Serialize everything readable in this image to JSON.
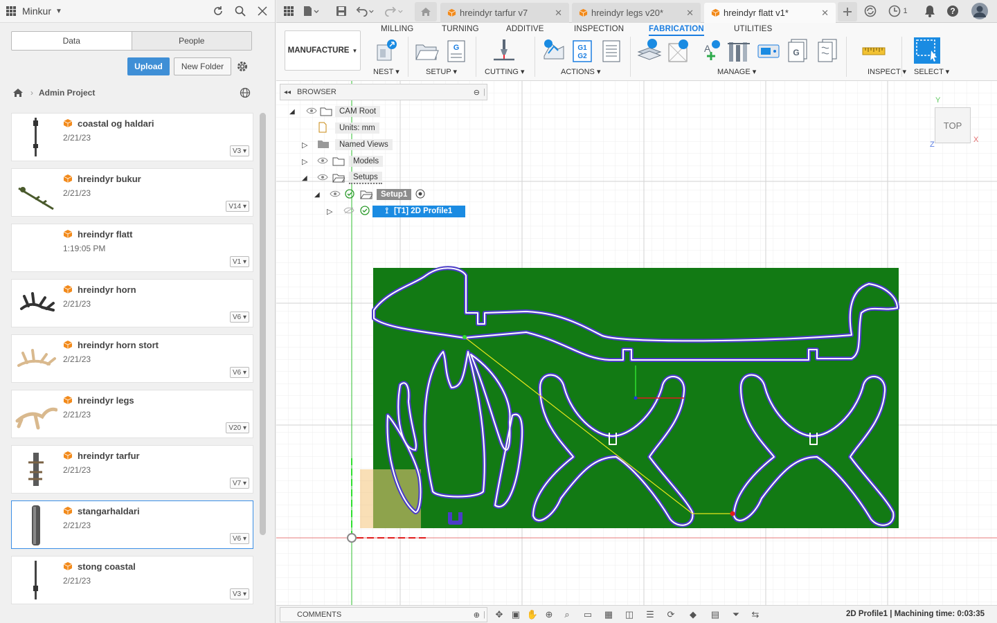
{
  "left_panel": {
    "app_name": "Minkur",
    "tabs": [
      "Data",
      "People"
    ],
    "upload_label": "Upload",
    "new_folder_label": "New Folder",
    "breadcrumb": "Admin Project",
    "files": [
      {
        "name": "coastal og haldari",
        "date": "2/21/23",
        "version": "V3"
      },
      {
        "name": "hreindyr bukur",
        "date": "2/21/23",
        "version": "V14"
      },
      {
        "name": "hreindyr flatt",
        "date": "1:19:05 PM",
        "version": "V1"
      },
      {
        "name": "hreindyr horn",
        "date": "2/21/23",
        "version": "V6"
      },
      {
        "name": "hreindyr horn stort",
        "date": "2/21/23",
        "version": "V6"
      },
      {
        "name": "hreindyr legs",
        "date": "2/21/23",
        "version": "V20"
      },
      {
        "name": "hreindyr tarfur",
        "date": "2/21/23",
        "version": "V7"
      },
      {
        "name": "stangarhaldari",
        "date": "2/21/23",
        "version": "V6",
        "selected": true
      },
      {
        "name": "stong coastal",
        "date": "2/21/23",
        "version": "V3"
      }
    ]
  },
  "doc_tabs": [
    {
      "label": "hreindyr tarfur v7",
      "active": false
    },
    {
      "label": "hreindyr legs v20*",
      "active": false
    },
    {
      "label": "hreindyr flatt v1*",
      "active": true
    }
  ],
  "notifications_count": "1",
  "ribbon": {
    "workspace": "MANUFACTURE",
    "tabs": [
      "MILLING",
      "TURNING",
      "ADDITIVE",
      "INSPECTION",
      "FABRICATION",
      "UTILITIES"
    ],
    "active_tab": "FABRICATION",
    "groups": [
      "NEST",
      "SETUP",
      "CUTTING",
      "ACTIONS",
      "MANAGE",
      "INSPECT",
      "SELECT"
    ],
    "g_code_label": "G1\nG2",
    "g_label": "G"
  },
  "browser": {
    "title": "BROWSER",
    "nodes": {
      "root": "CAM Root",
      "units": "Units: mm",
      "named_views": "Named Views",
      "models": "Models",
      "setups": "Setups",
      "setup1": "Setup1",
      "profile": "[T1] 2D Profile1"
    }
  },
  "viewcube": {
    "face": "TOP",
    "axis_x": "X",
    "axis_y": "Y",
    "axis_z": "Z"
  },
  "bottom": {
    "comments": "COMMENTS",
    "status": "2D Profile1 | Machining time: 0:03:35"
  },
  "colors": {
    "accent": "#1a7de0",
    "stock": "#127a14",
    "toolpath": "#4b3cc7",
    "upload": "#3f8fd6"
  }
}
